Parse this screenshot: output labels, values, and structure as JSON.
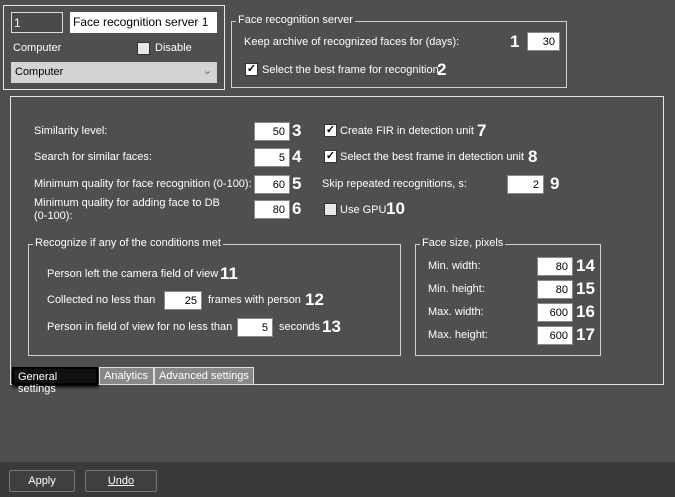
{
  "header": {
    "id": "1",
    "name": "Face recognition server 1",
    "computer_label": "Computer",
    "disable_label": "Disable",
    "disable_checked": false,
    "computer_select": "Computer"
  },
  "server_group": {
    "title": "Face recognition server",
    "archive_label": "Keep archive of recognized faces for (days):",
    "archive_value": "30",
    "best_frame_label": "Select the best frame for recognition",
    "best_frame_checked": true,
    "n1": "1",
    "n2": "2"
  },
  "settings": {
    "similarity": {
      "label": "Similarity level:",
      "value": "50",
      "n": "3"
    },
    "search": {
      "label": "Search for similar faces:",
      "value": "5",
      "n": "4"
    },
    "min_quality": {
      "label": "Minimum quality for face recognition (0-100):",
      "value": "60",
      "n": "5"
    },
    "min_quality_db": {
      "label1": "Minimum quality for adding face to DB",
      "label2": "(0-100):",
      "value": "80",
      "n": "6"
    },
    "create_fir": {
      "label": "Create FIR in detection unit",
      "checked": true,
      "n": "7"
    },
    "best_frame_unit": {
      "label": "Select the best frame in detection unit",
      "checked": true,
      "n": "8"
    },
    "skip": {
      "label": "Skip repeated recognitions, s:",
      "value": "2",
      "n": "9"
    },
    "gpu": {
      "label": "Use GPU",
      "checked": false,
      "n": "10"
    }
  },
  "conditions": {
    "title": "Recognize if any of the conditions met",
    "left_label": "Person left the camera field of view",
    "n11": "11",
    "collected_pre": "Collected no less than",
    "collected_value": "25",
    "collected_post": "frames with person",
    "n12": "12",
    "infield_pre": "Person in field of view for no less than",
    "infield_value": "5",
    "infield_post": "seconds",
    "n13": "13"
  },
  "face_size": {
    "title": "Face size, pixels",
    "rows": [
      {
        "label": "Min. width:",
        "value": "80",
        "n": "14"
      },
      {
        "label": "Min. height:",
        "value": "80",
        "n": "15"
      },
      {
        "label": "Max. width:",
        "value": "600",
        "n": "16"
      },
      {
        "label": "Max. height:",
        "value": "600",
        "n": "17"
      }
    ]
  },
  "tabs": [
    "General settings",
    "Analytics",
    "Advanced settings"
  ],
  "buttons": {
    "apply": "Apply",
    "undo": "Undo"
  }
}
